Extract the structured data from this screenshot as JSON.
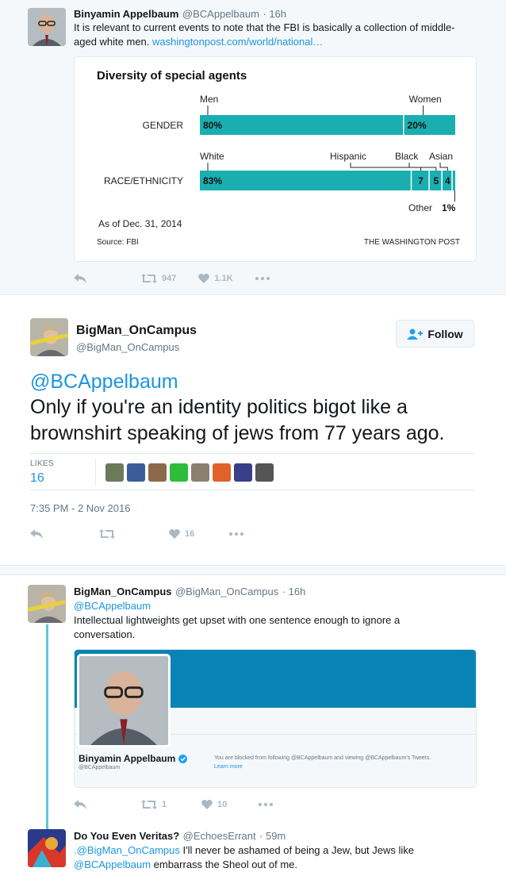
{
  "tweet1": {
    "author_name": "Binyamin Appelbaum",
    "author_handle": "@BCAppelbaum",
    "time": "· 16h",
    "text": "It is relevant to current events to note that the FBI is basically a collection of middle-aged white men.",
    "link": "washingtonpost.com/world/national…",
    "retweets": "947",
    "likes": "1.1K"
  },
  "chart_data": {
    "type": "bar",
    "title": "Diversity of special agents",
    "rows": [
      {
        "label": "GENDER",
        "segments": [
          {
            "name": "Men",
            "value": 80,
            "text": "80%"
          },
          {
            "name": "Women",
            "value": 20,
            "text": "20%"
          }
        ]
      },
      {
        "label": "RACE/ETHNICITY",
        "segments": [
          {
            "name": "White",
            "value": 83,
            "text": "83%"
          },
          {
            "name": "Hispanic",
            "value": 7,
            "text": "7"
          },
          {
            "name": "Black",
            "value": 5,
            "text": "5"
          },
          {
            "name": "Asian",
            "value": 4,
            "text": "4"
          },
          {
            "name": "Other",
            "value": 1,
            "text": "1%"
          }
        ]
      }
    ],
    "other_label": "Other",
    "other_value": "1%",
    "note": "As of Dec. 31, 2014",
    "source": "Source: FBI",
    "credit": "THE WASHINGTON POST",
    "color": "#1aaeb1"
  },
  "focus": {
    "author_name": "BigMan_OnCampus",
    "author_handle": "@BigMan_OnCampus",
    "follow_label": "Follow",
    "mention": "@BCAppelbaum",
    "text": "Only if you're an identity politics bigot like a brownshirt speaking of jews from 77 years ago.",
    "likes_label": "LIKES",
    "likes_count": "16",
    "timestamp": "7:35 PM - 2 Nov 2016",
    "like_action_count": "16",
    "liker_colors": [
      "#6b7a5a",
      "#3a5d9a",
      "#8a6a4a",
      "#2dbd3a",
      "#8a8070",
      "#e0622a",
      "#3a3f8a",
      "#555555"
    ]
  },
  "reply1": {
    "author_name": "BigMan_OnCampus",
    "author_handle": "@BigMan_OnCampus",
    "time": "· 16h",
    "mention": "@BCAppelbaum",
    "text": "Intellectual lightweights get upset with one sentence enough to ignore a conversation.",
    "card_name": "Binyamin Appelbaum",
    "card_handle": "@BCAppelbaum",
    "blocked_text": "You are blocked from following @BCAppelbaum and viewing @BCAppelbaum's Tweets.",
    "learn_more": "Learn more",
    "retweets": "1",
    "likes": "10"
  },
  "reply2": {
    "author_name": "Do You Even Veritas?",
    "author_handle": "@EchoesErrant",
    "time": "· 59m",
    "mention": ".@BigMan_OnCampus",
    "text": " I'll never be ashamed of being a Jew, but Jews like",
    "mention2": "@BCAppelbaum",
    "text2": " embarrass the Sheol out of me."
  }
}
